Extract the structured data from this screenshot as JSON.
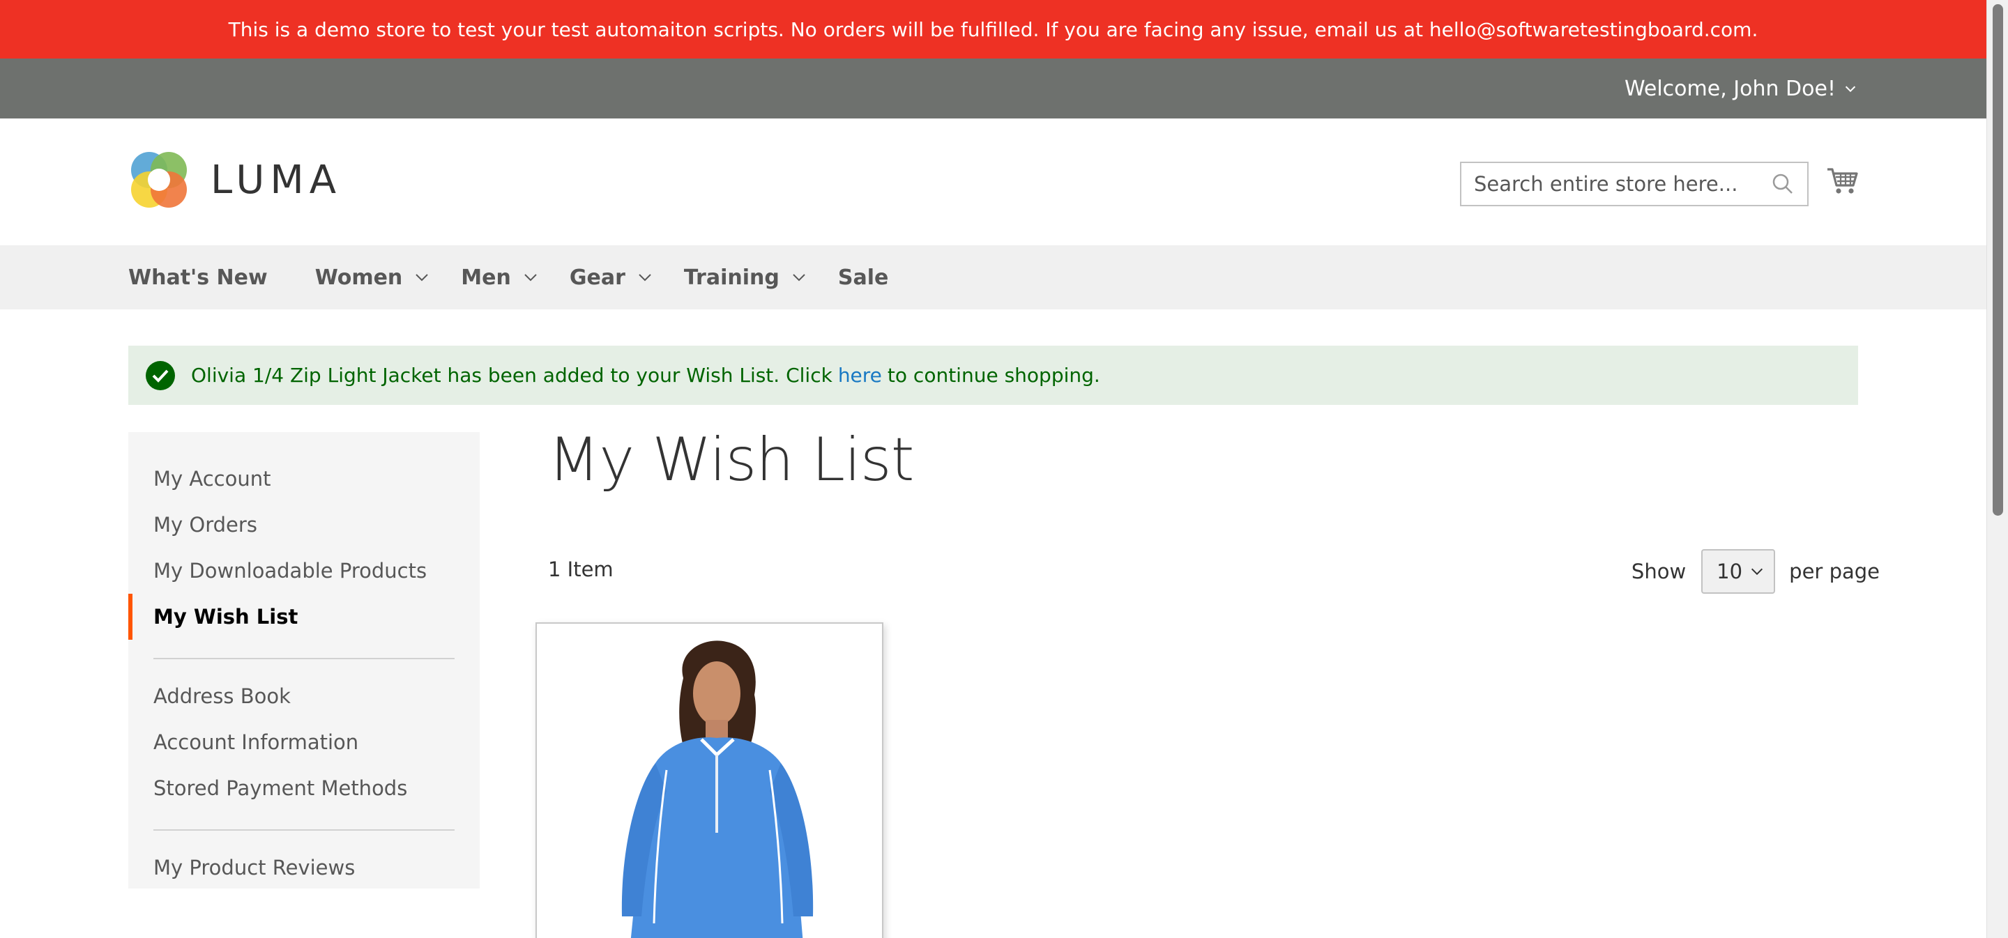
{
  "demo_banner": {
    "text": "This is a demo store to test your test automaiton scripts. No orders will be fulfilled. If you are facing any issue, email us at hello@softwaretestingboard.com."
  },
  "top_panel": {
    "welcome": "Welcome, John Doe!"
  },
  "header": {
    "logo_text": "LUMA",
    "search_placeholder": "Search entire store here..."
  },
  "nav": {
    "items": [
      {
        "label": "What's New",
        "has_dropdown": false
      },
      {
        "label": "Women",
        "has_dropdown": true
      },
      {
        "label": "Men",
        "has_dropdown": true
      },
      {
        "label": "Gear",
        "has_dropdown": true
      },
      {
        "label": "Training",
        "has_dropdown": true
      },
      {
        "label": "Sale",
        "has_dropdown": false
      }
    ]
  },
  "message": {
    "prefix": "Olivia 1/4 Zip Light Jacket has been added to your Wish List. Click",
    "link": "here",
    "suffix": "to continue shopping."
  },
  "sidebar": {
    "items": [
      {
        "label": "My Account"
      },
      {
        "label": "My Orders"
      },
      {
        "label": "My Downloadable Products"
      },
      {
        "label": "My Wish List",
        "current": true
      },
      {
        "label": "Address Book"
      },
      {
        "label": "Account Information"
      },
      {
        "label": "Stored Payment Methods"
      },
      {
        "label": "My Product Reviews"
      }
    ]
  },
  "main": {
    "title": "My Wish List",
    "item_count": "1 Item",
    "limiter": {
      "show_label": "Show",
      "value": "10",
      "per_page_label": "per page"
    }
  },
  "colors": {
    "banner": "#ee3124",
    "top_panel": "#6e716e",
    "nav_bg": "#f0f0f0",
    "message_bg": "#e5efe5",
    "message_text": "#006400",
    "link": "#1979c3",
    "current_marker": "#ff5501",
    "jacket": "#4a8fe0"
  }
}
